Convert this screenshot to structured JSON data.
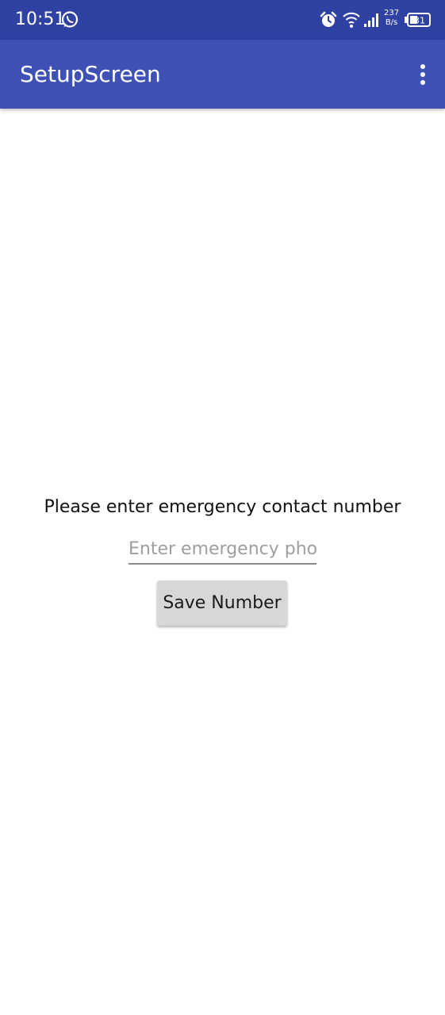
{
  "status_bar": {
    "time": "10:51",
    "net_speed_value": "237",
    "net_speed_unit": "B/s",
    "battery_level": "31",
    "icons": [
      "whatsapp-icon",
      "alarm-icon",
      "wifi-icon",
      "signal-icon",
      "battery-icon"
    ]
  },
  "app_bar": {
    "title": "SetupScreen",
    "overflow_icon": "more-vert-icon"
  },
  "main": {
    "prompt": "Please enter emergency contact number",
    "phone_input": {
      "value": "",
      "placeholder": "Enter emergency phone number"
    },
    "save_button_label": "Save Number"
  },
  "colors": {
    "status_bar": "#3041a4",
    "app_bar": "#3f51b5",
    "button_bg": "#d6d7d7",
    "background": "#ffffff"
  }
}
